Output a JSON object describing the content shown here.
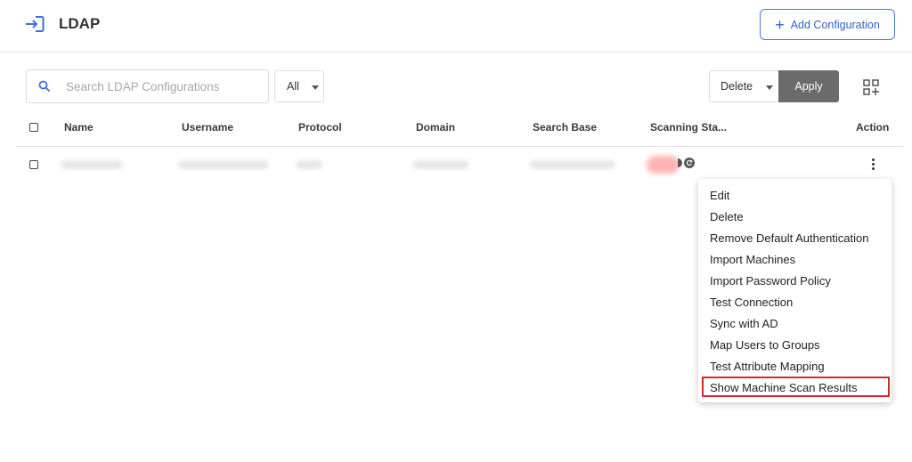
{
  "header": {
    "title": "LDAP",
    "add_button_label": "Add Configuration",
    "accent_color": "#2f66c8"
  },
  "toolbar": {
    "search_placeholder": "Search LDAP Configurations",
    "search_value": "",
    "filter_selected": "All",
    "bulk_action_selected": "Delete",
    "apply_label": "Apply"
  },
  "table": {
    "columns": [
      "Name",
      "Username",
      "Protocol",
      "Domain",
      "Search Base",
      "Scanning Sta...",
      "Action"
    ]
  },
  "action_menu": {
    "items": [
      "Edit",
      "Delete",
      "Remove Default Authentication",
      "Import Machines",
      "Import Password Policy",
      "Test Connection",
      "Sync with AD",
      "Map Users to Groups",
      "Test Attribute Mapping",
      "Show Machine Scan Results"
    ],
    "highlighted_item": "Show Machine Scan Results",
    "highlight_color": "#d62a2a"
  }
}
